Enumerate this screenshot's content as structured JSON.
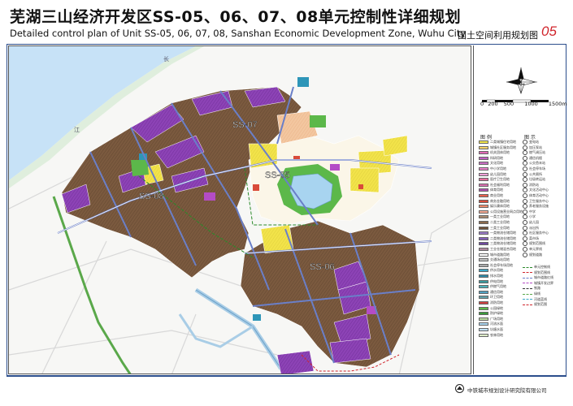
{
  "title_cn": "芜湖三山经济开发区SS-05、06、07、08单元控制性详细规划",
  "title_en": "Detailed control plan of Unit SS-05, 06, 07, 08, Sanshan Economic Development Zone, Wuhu City",
  "map_name": "国土空间利用规划图",
  "map_number": "05",
  "units": [
    {
      "label": "SS-07"
    },
    {
      "label": "SS-05"
    },
    {
      "label": "SS-08"
    },
    {
      "label": "SS-06"
    }
  ],
  "river_labels": [
    "长",
    "江"
  ],
  "scale": {
    "ticks": [
      "0",
      "200",
      "500",
      "1000",
      "1500m"
    ]
  },
  "legend": {
    "col1_title": "图 例",
    "col2_title": "图 示",
    "col1_items": [
      {
        "label": "二类城镇住宅用地",
        "color": "#f2e64a"
      },
      {
        "label": "城镇社区服务用地",
        "color": "#f7d36a"
      },
      {
        "label": "机关团体用地",
        "color": "#e06ab5"
      },
      {
        "label": "科研用地",
        "color": "#c060c0"
      },
      {
        "label": "文化用地",
        "color": "#c96cc3"
      },
      {
        "label": "中小学用地",
        "color": "#e880c8"
      },
      {
        "label": "幼儿园用地",
        "color": "#f0a0d8"
      },
      {
        "label": "医疗卫生用地",
        "color": "#e46c9c"
      },
      {
        "label": "社会福利用地",
        "color": "#d86fae"
      },
      {
        "label": "体育用地",
        "color": "#b04fb0"
      },
      {
        "label": "商业用地",
        "color": "#e8624e"
      },
      {
        "label": "商务金融用地",
        "color": "#d94b3a"
      },
      {
        "label": "娱乐康体用地",
        "color": "#ef8a6c"
      },
      {
        "label": "公用设施营业网点用地",
        "color": "#f3a690"
      },
      {
        "label": "一类工业用地",
        "color": "#a88a70"
      },
      {
        "label": "二类工业用地",
        "color": "#8a6a4d"
      },
      {
        "label": "三类工业用地",
        "color": "#6e5139"
      },
      {
        "label": "一类物流仓储用地",
        "color": "#9a7ac8"
      },
      {
        "label": "二类物流仓储用地",
        "color": "#8460b8"
      },
      {
        "label": "三类物流仓储用地",
        "color": "#6e48a0"
      },
      {
        "label": "工业仓储混合用地",
        "color": "#b08aa0"
      },
      {
        "label": "城市道路用地",
        "color": "#ffffff"
      },
      {
        "label": "交通场站用地",
        "color": "#c0c0c0"
      },
      {
        "label": "社会停车场用地",
        "color": "#aaaaaa"
      },
      {
        "label": "供水用地",
        "color": "#3aa8c8"
      },
      {
        "label": "排水用地",
        "color": "#2e8aa8"
      },
      {
        "label": "供电用地",
        "color": "#3a9aa0"
      },
      {
        "label": "供燃气用地",
        "color": "#4ab0b8"
      },
      {
        "label": "通信用地",
        "color": "#50a0c0"
      },
      {
        "label": "环卫用地",
        "color": "#60a0a8"
      },
      {
        "label": "消防用地",
        "color": "#d04040"
      },
      {
        "label": "公园绿地",
        "color": "#5cb84a"
      },
      {
        "label": "防护绿地",
        "color": "#3a9a3a"
      },
      {
        "label": "广场用地",
        "color": "#b8d8a0"
      },
      {
        "label": "河流水面",
        "color": "#a8d4f0"
      },
      {
        "label": "坑塘水面",
        "color": "#c0e0f8"
      },
      {
        "label": "农林用地",
        "color": "#dcebc8"
      }
    ],
    "col2_items": [
      {
        "label": "变电站"
      },
      {
        "label": "加压泵站"
      },
      {
        "label": "燃气调压站"
      },
      {
        "label": "通信机楼"
      },
      {
        "label": "公交首末站"
      },
      {
        "label": "社会停车场"
      },
      {
        "label": "公共厕所"
      },
      {
        "label": "垃圾转运站"
      },
      {
        "label": "消防站"
      },
      {
        "label": "文化活动中心"
      },
      {
        "label": "体育活动中心"
      },
      {
        "label": "卫生服务中心"
      },
      {
        "label": "养老服务设施"
      },
      {
        "label": "中学"
      },
      {
        "label": "小学"
      },
      {
        "label": "幼儿园"
      },
      {
        "label": "派出所"
      },
      {
        "label": "社区服务中心"
      },
      {
        "label": "菜市场"
      },
      {
        "label": "规划范围线"
      },
      {
        "label": "单元界线"
      },
      {
        "label": "规划道路"
      }
    ],
    "line_items": [
      {
        "label": "单元控制线"
      },
      {
        "label": "规划范围线"
      },
      {
        "label": "城市道路红线"
      },
      {
        "label": "城镇开发边界"
      },
      {
        "label": "铁路"
      },
      {
        "label": "绿线"
      },
      {
        "label": "河道蓝线"
      },
      {
        "label": "规划范围"
      }
    ]
  },
  "company": "中铁城市规划设计研究院有限公司",
  "colors": {
    "industrial": "#7a5a3e",
    "logistics": "#8b3fb3",
    "residential": "#f0e24a",
    "water": "#a8d4f0",
    "green": "#5cb84a",
    "road": "#6a7fc8",
    "frame": "#2b4e8c"
  }
}
